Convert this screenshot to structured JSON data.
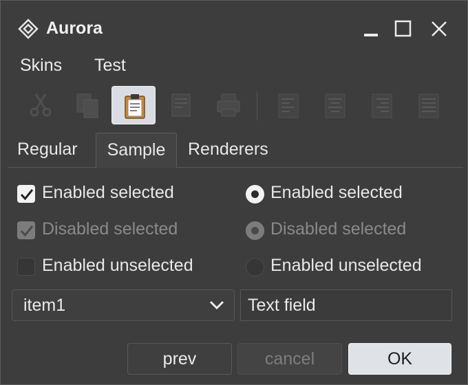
{
  "window": {
    "title": "Aurora",
    "controls": [
      "minimize-icon",
      "maximize-icon",
      "close-icon"
    ]
  },
  "menu": {
    "items": [
      {
        "label": "Skins"
      },
      {
        "label": "Test"
      }
    ]
  },
  "toolbar": {
    "tools": [
      {
        "icon": "cut-icon",
        "enabled": false
      },
      {
        "icon": "copy-icon",
        "enabled": false
      },
      {
        "icon": "paste-icon",
        "enabled": true,
        "active": true
      },
      {
        "icon": "document-icon",
        "enabled": false
      },
      {
        "icon": "print-icon",
        "enabled": false
      },
      {
        "icon": "align-left-icon",
        "enabled": false
      },
      {
        "icon": "align-center-icon",
        "enabled": false
      },
      {
        "icon": "align-right-icon",
        "enabled": false
      },
      {
        "icon": "align-justify-icon",
        "enabled": false
      }
    ]
  },
  "tabs": {
    "items": [
      {
        "label": "Regular"
      },
      {
        "label": "Sample"
      },
      {
        "label": "Renderers"
      }
    ],
    "selected": "Sample"
  },
  "checkboxes": [
    {
      "label": "Enabled selected",
      "checked": true,
      "enabled": true
    },
    {
      "label": "Disabled selected",
      "checked": true,
      "enabled": false
    },
    {
      "label": "Enabled unselected",
      "checked": false,
      "enabled": true
    }
  ],
  "radios": [
    {
      "label": "Enabled selected",
      "checked": true,
      "enabled": true
    },
    {
      "label": "Disabled selected",
      "checked": true,
      "enabled": false
    },
    {
      "label": "Enabled unselected",
      "checked": false,
      "enabled": true
    }
  ],
  "combo": {
    "value": "item1",
    "icon": "chevron-down-icon"
  },
  "text_field": {
    "value": "Text field"
  },
  "buttons": {
    "prev": {
      "label": "prev",
      "enabled": true
    },
    "cancel": {
      "label": "cancel",
      "enabled": false
    },
    "ok": {
      "label": "OK",
      "enabled": true
    }
  },
  "colors": {
    "background": "#3d3d3d",
    "text": "#e8e8e8",
    "disabled_text": "#8a8a8a",
    "ok_button": "#dfe3e8"
  }
}
